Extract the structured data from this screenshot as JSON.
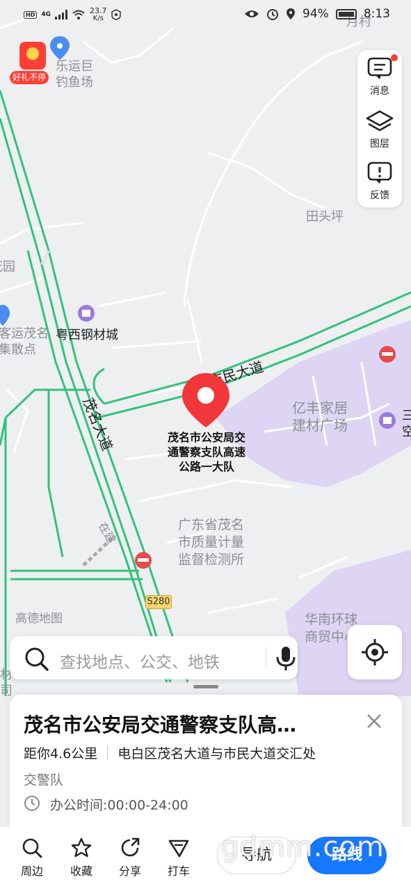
{
  "status_bar": {
    "left_badge": "HD",
    "network": "4G",
    "speed_value": "23.7",
    "speed_unit": "K/s",
    "battery": "94%",
    "time": "8:13"
  },
  "gift": {
    "tag": "好礼不停"
  },
  "tools": [
    {
      "label": "消息",
      "icon": "message-icon",
      "has_dot": true
    },
    {
      "label": "图层",
      "icon": "layers-icon"
    },
    {
      "label": "反馈",
      "icon": "feedback-icon"
    }
  ],
  "map_labels": {
    "top_poi": "乐运巨\n钓鱼场",
    "top_right": "月村",
    "tiantouping": "田头坪",
    "garden": "花园",
    "bus_station": "客运茂名\n集散点",
    "steel_city": "粤西钢材城",
    "road_minmin": "市民大道",
    "road_maoming": "茂名大道",
    "yifeng": "亿丰家居\n建材广场",
    "edge_right": "三\n空",
    "guangdong_qa": "广东省茂名\n市质量计量\n监督检测所",
    "under_construction": "在建",
    "s280": "S280",
    "gaode": "高德地图",
    "huanan": "华南环球\n商贸中心",
    "edge_left": "材\n司"
  },
  "pin": {
    "label": "茂名市公安局交\n通警察支队高速\n公路一大队",
    "color": "#f2373a"
  },
  "search": {
    "placeholder": "查找地点、公交、地铁"
  },
  "card": {
    "title": "茂名市公安局交通警察支队高…",
    "distance": "距你4.6公里",
    "address": "电白区茂名大道与市民大道交汇处",
    "category": "交警队",
    "hours": "办公时间:00:00-24:00"
  },
  "bottom_bar": {
    "items": [
      {
        "label": "周边",
        "icon": "search-around-icon"
      },
      {
        "label": "收藏",
        "icon": "star-icon"
      },
      {
        "label": "分享",
        "icon": "share-icon"
      },
      {
        "label": "打车",
        "icon": "taxi-icon"
      }
    ],
    "nav": "导航",
    "route": "路线",
    "accent": "#1677ff"
  },
  "watermark": "gdmm.com"
}
